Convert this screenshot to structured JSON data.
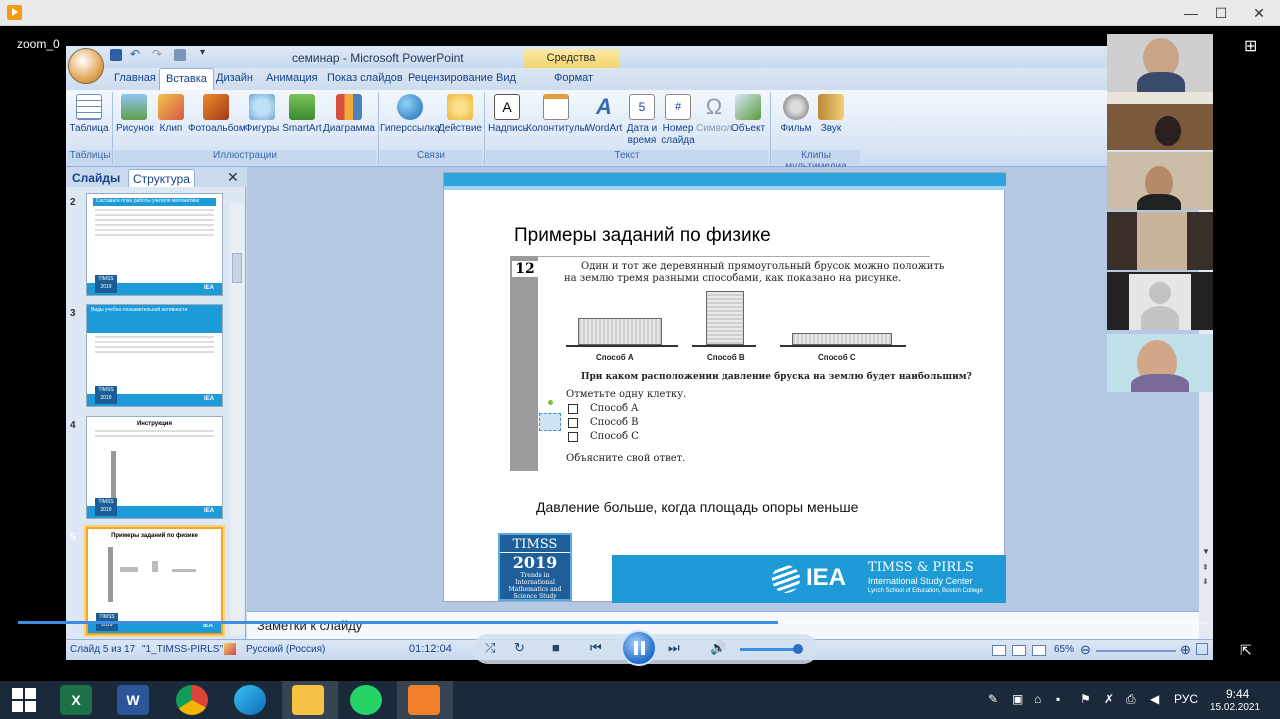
{
  "player": {
    "window_title": "",
    "overlay_label": "zoom_0",
    "timecode": "01:12:04"
  },
  "ppt": {
    "title": "семинар - Microsoft PowerPoint",
    "context_tab": "Средства рисования",
    "tabs": [
      "Главная",
      "Вставка",
      "Дизайн",
      "Анимация",
      "Показ слайдов",
      "Рецензирование",
      "Вид",
      "Формат"
    ],
    "ribbon": {
      "buttons": [
        {
          "label": "Таблица",
          "icon": "table-icon"
        },
        {
          "label": "Рисунок",
          "icon": "picture-icon"
        },
        {
          "label": "Клип",
          "icon": "clipart-icon"
        },
        {
          "label": "Фотоальбом",
          "icon": "photo-album-icon"
        },
        {
          "label": "Фигуры",
          "icon": "shapes-icon"
        },
        {
          "label": "SmartArt",
          "icon": "smartart-icon"
        },
        {
          "label": "Диаграмма",
          "icon": "chart-icon"
        },
        {
          "label": "Гиперссылка",
          "icon": "hyperlink-icon"
        },
        {
          "label": "Действие",
          "icon": "action-icon"
        },
        {
          "label": "Надпись",
          "icon": "textbox-icon"
        },
        {
          "label": "Колонтитулы",
          "icon": "header-footer-icon"
        },
        {
          "label": "WordArt",
          "icon": "wordart-icon"
        },
        {
          "label": "Дата и время",
          "icon": "date-time-icon"
        },
        {
          "label": "Номер слайда",
          "icon": "slide-number-icon"
        },
        {
          "label": "Символ",
          "icon": "symbol-icon"
        },
        {
          "label": "Объект",
          "icon": "object-icon"
        },
        {
          "label": "Фильм",
          "icon": "movie-icon"
        },
        {
          "label": "Звук",
          "icon": "sound-icon"
        }
      ],
      "groups": [
        "Таблицы",
        "Иллюстрации",
        "Связи",
        "Текст",
        "Клипы мультимедиа"
      ]
    },
    "pane_tabs": [
      "Слайды",
      "Структура"
    ],
    "thumbnails": [
      {
        "num": "2",
        "title": "Составьте план работы учителя математики"
      },
      {
        "num": "3",
        "title": "Виды учебно-познавательной активности"
      },
      {
        "num": "4",
        "title": "Инструкция"
      },
      {
        "num": "5",
        "title": "Примеры заданий по физике"
      }
    ],
    "notes_placeholder": "Заметки к слайду",
    "status": {
      "slide_info": "Слайд 5 из 17",
      "theme": "\"1_TIMSS-PIRLS\"",
      "language": "Русский (Россия)",
      "zoom": "65%"
    }
  },
  "slide": {
    "title": "Примеры заданий по физике",
    "question_number": "12",
    "question_line1": "Один и тот же деревянный прямоугольный брусок можно положить",
    "question_line2": "на землю тремя разными способами, как показано на рисунке.",
    "ways": [
      "Способ A",
      "Способ B",
      "Способ C"
    ],
    "prompt": "При каком расположении давление бруска на землю будет наибольшим?",
    "instruction": "Отметьте одну клетку.",
    "options": [
      "Способ A",
      "Способ B",
      "Способ C"
    ],
    "explain": "Объясните свой ответ.",
    "answer": "Давление больше, когда площадь опоры меньше",
    "timss": {
      "line1": "TIMSS",
      "line2": "2019",
      "line3": "Trends in International Mathematics and Science Study"
    },
    "iea": {
      "logo": "IEA",
      "brand": "TIMSS & PIRLS",
      "center": "International Study Center",
      "school": "Lynch School of Education, Boston College"
    }
  },
  "taskbar": {
    "lang": "РУС",
    "time": "9:44",
    "date": "15.02.2021",
    "apps": [
      "excel-icon",
      "word-icon",
      "chrome-icon",
      "edge-icon",
      "file-explorer-icon",
      "whatsapp-icon",
      "media-player-icon"
    ]
  },
  "colors": {
    "ribbon_accent": "#15428b",
    "slide_bar": "#2ea4dc",
    "timss_blue": "#1e5f9b",
    "taskbar": "#1b2a3a"
  }
}
